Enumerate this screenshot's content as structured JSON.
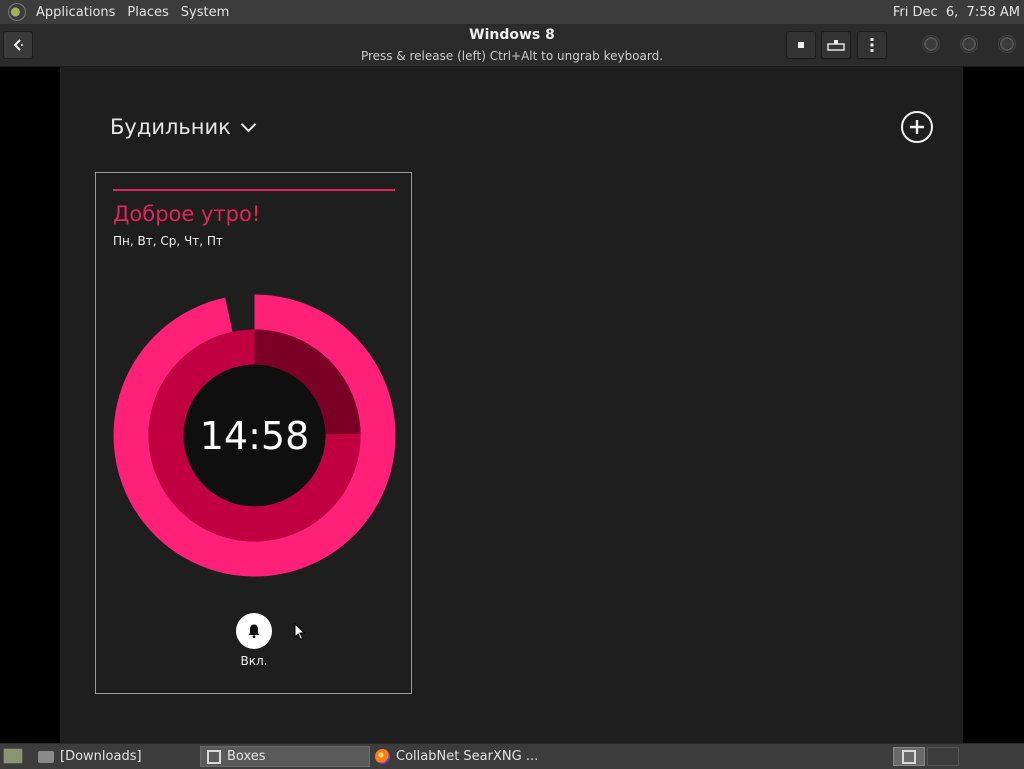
{
  "top_panel": {
    "menus": [
      "Applications",
      "Places",
      "System"
    ],
    "clock": "Fri Dec  6,  7:58 AM"
  },
  "boxes_header": {
    "title": "Windows 8",
    "subtitle": "Press & release (left) Ctrl+Alt to ungrab keyboard.",
    "icons": {
      "back": "arrow-left-icon",
      "stop": "stop-icon",
      "keyboard": "keyboard-icon",
      "menu": "kebab-menu-icon"
    }
  },
  "alarm_app": {
    "title": "Будильник",
    "alarm": {
      "name": "Доброе утро!",
      "days": "Пн, Вт, Ср, Чт, Пт",
      "time": "14:58",
      "toggle_label": "Вкл.",
      "hour_hand": 14,
      "minute_hand": 58
    },
    "colors": {
      "accent": "#e0245e",
      "outer_ring": "#ff2177",
      "inner_ring": "#c00040",
      "inner_ring_shade": "#7a0026",
      "background": "#1e1e1e"
    }
  },
  "taskbar": {
    "tasks": [
      {
        "label": "[Downloads]",
        "icon": "folder-icon",
        "active": false
      },
      {
        "label": "Boxes",
        "icon": "boxes-icon",
        "active": true
      },
      {
        "label": "CollabNet SearXNG ...",
        "icon": "firefox-icon",
        "active": false
      }
    ]
  }
}
